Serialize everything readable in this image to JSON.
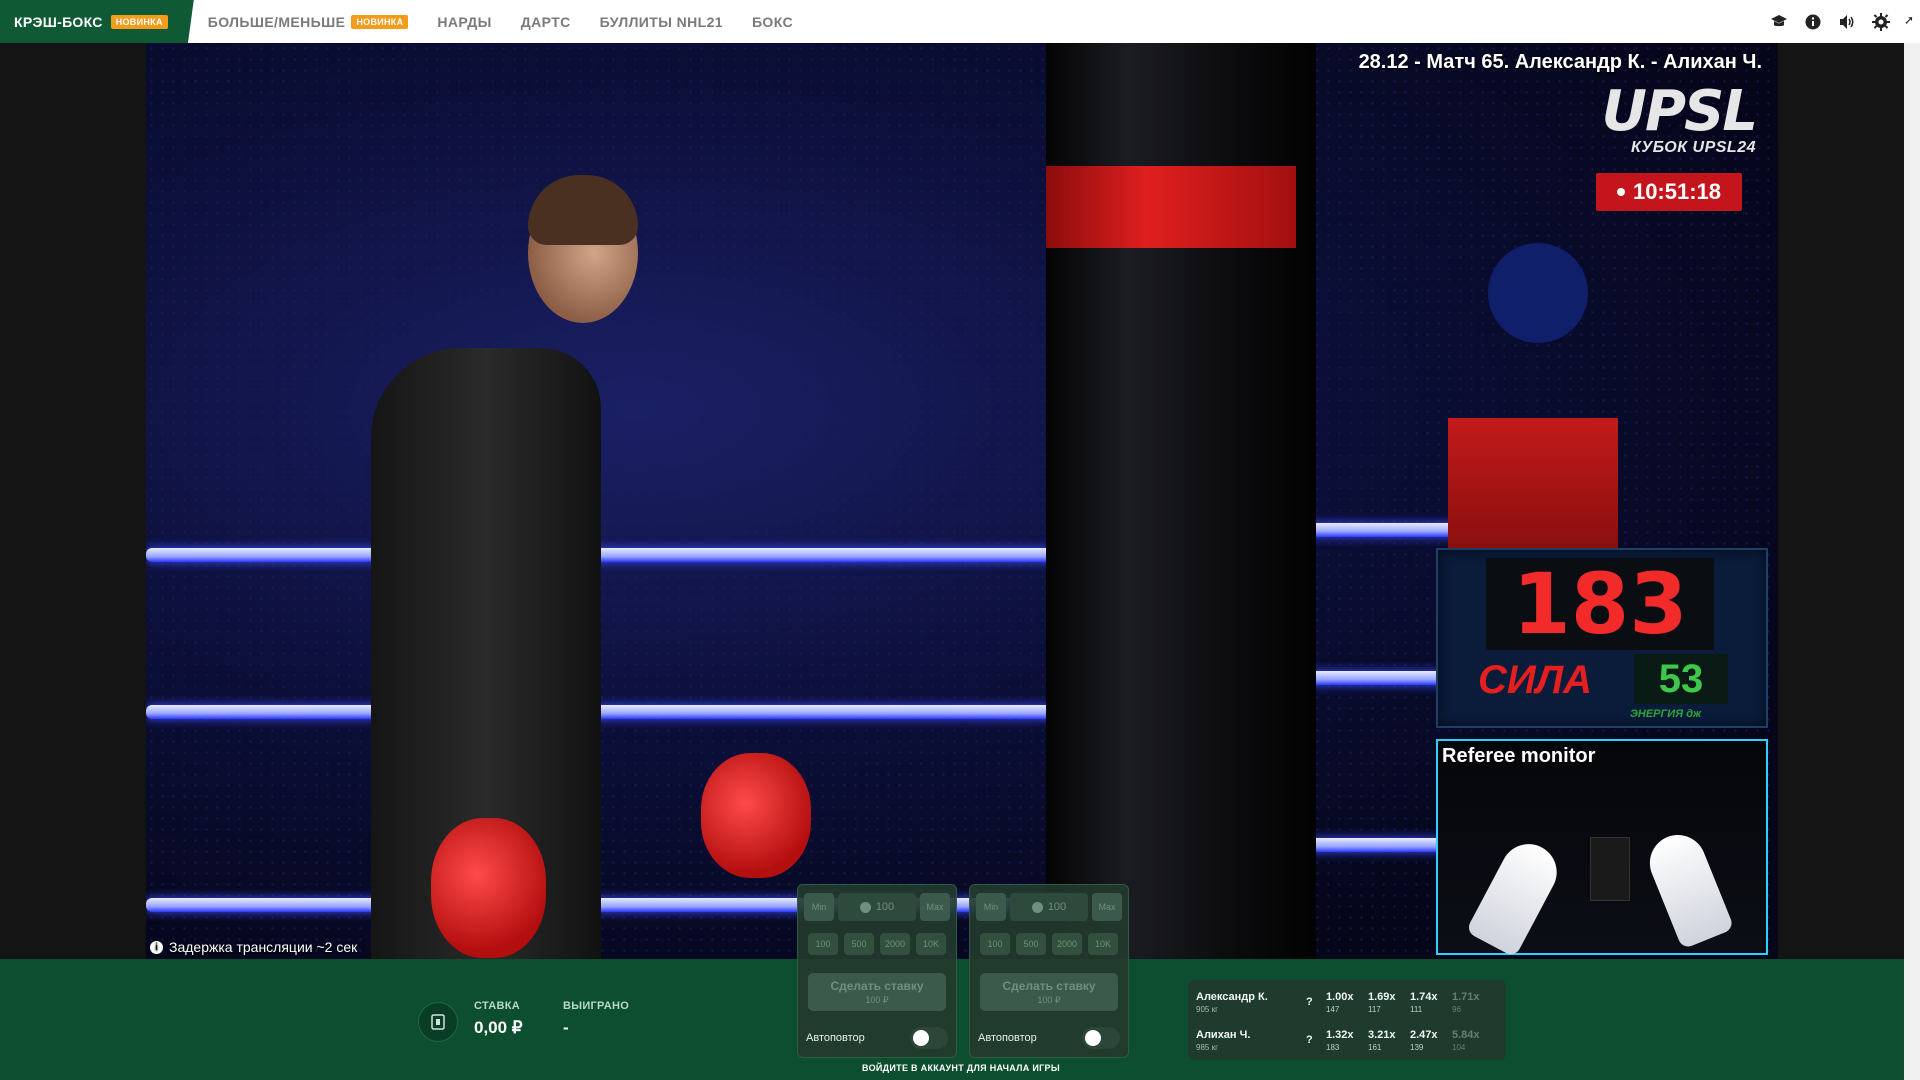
{
  "nav": {
    "brand": "КРЭШ-БОКС",
    "brand_badge": "НОВИНКА",
    "items": [
      {
        "label": "БОЛЬШЕ/МЕНЬШЕ",
        "badge": "НОВИНКА"
      },
      {
        "label": "НАРДЫ"
      },
      {
        "label": "ДАРТС"
      },
      {
        "label": "БУЛЛИТЫ NHL21"
      },
      {
        "label": "БОКС"
      }
    ],
    "icons": [
      "graduation-cap-icon",
      "info-icon",
      "volume-icon",
      "gear-icon"
    ]
  },
  "stream": {
    "match_title": "28.12 - Матч 65. Александр К. - Алихан Ч.",
    "logo": "UPSL",
    "cup": "КУБОК UPSL24",
    "clock": "10:51:18",
    "power_value": "183",
    "power_label": "СИЛА",
    "energy_value": "53",
    "energy_label": "ЭНЕРГИЯ дж",
    "referee_title": "Referee monitor",
    "delay_note": "Задержка трансляции ~2 сек"
  },
  "bottom": {
    "stake_label": "СТАВКА",
    "stake_value": "0,00 ₽",
    "won_label": "ВЫИГРАНО",
    "won_value": "-",
    "login_note": "ВОЙДИТЕ В АККАУНТ ДЛЯ НАЧАЛА ИГРЫ"
  },
  "bet_panels": [
    {
      "min": "Min",
      "amount": "100",
      "max": "Max",
      "chips": [
        "100",
        "500",
        "2000",
        "10K"
      ],
      "make": "Сделать ставку",
      "make_sub": "100 ₽",
      "auto": "Автоповтор"
    },
    {
      "min": "Min",
      "amount": "100",
      "max": "Max",
      "chips": [
        "100",
        "500",
        "2000",
        "10K"
      ],
      "make": "Сделать ставку",
      "make_sub": "100 ₽",
      "auto": "Автоповтор"
    }
  ],
  "odds": [
    {
      "name": "Александр К.",
      "weight": "905 кг",
      "q": "?",
      "cells": [
        {
          "c": "1.00x",
          "s": "147"
        },
        {
          "c": "1.69x",
          "s": "117"
        },
        {
          "c": "1.74x",
          "s": "111"
        },
        {
          "c": "1.71x",
          "s": "96"
        }
      ]
    },
    {
      "name": "Алихан Ч.",
      "weight": "985 кг",
      "q": "?",
      "cells": [
        {
          "c": "1.32x",
          "s": "183"
        },
        {
          "c": "3.21x",
          "s": "161"
        },
        {
          "c": "2.47x",
          "s": "139"
        },
        {
          "c": "5.84x",
          "s": "104"
        }
      ]
    }
  ],
  "colors": {
    "brand_green": "#0f5a34",
    "badge_orange": "#f39b1b",
    "live_red": "#c4151c"
  }
}
